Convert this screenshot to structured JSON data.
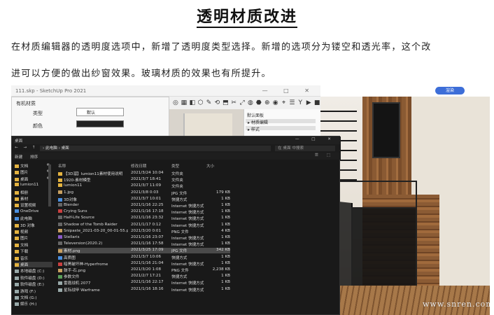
{
  "article": {
    "title": "透明材质改进",
    "paragraph_line1": "在材质编辑器的透明度选项中，新增了透明度类型选择。新增的选项分为镂空和透光率，这个改",
    "paragraph_line2": "进可以方便的做出纱窗效果。玻璃材质的效果也有所提升。"
  },
  "sketchup": {
    "window_title": "111.skp - SketchUp Pro 2021",
    "window_controls": "—  □  ✕",
    "dialog": {
      "section": "有机材质",
      "type_label": "类型",
      "type_value": "默认",
      "color_label": "颜色"
    },
    "tray": {
      "label": "默认面板",
      "items": [
        "▸ 材质编辑",
        "▸ 样式"
      ]
    },
    "render_button": "渲染",
    "toolbar_icons": [
      "◎",
      "▦",
      "◧",
      "⬡",
      "✎",
      "⟲",
      "⬒",
      "✂",
      "⤢",
      "◍",
      "⬣",
      "⊕",
      "◉",
      "⌖",
      "☰",
      "Y",
      "▶",
      "■"
    ]
  },
  "explorer": {
    "window_title": "桌面",
    "window_controls": "—  □  ✕",
    "nav_buttons": "← → ↑",
    "path": "› 此电脑 › 桌面",
    "search_placeholder": "在 桌面 中搜索",
    "command_bar": {
      "new": "新建",
      "tools": "☰ ⬚",
      "view": "排序"
    },
    "sidebar": [
      {
        "label": "文档",
        "icon": "folder",
        "pin": true
      },
      {
        "label": "图片",
        "icon": "folder",
        "pin": true
      },
      {
        "label": "桌面",
        "icon": "folder",
        "pin": true
      },
      {
        "label": "lumion11",
        "icon": "folder",
        "pin": false
      },
      {
        "label": "相册",
        "icon": "folder",
        "pin": false
      },
      {
        "label": "素材",
        "icon": "folder",
        "pin": false
      },
      {
        "label": "设置视频",
        "icon": "folder",
        "pin": false
      },
      {
        "label": "OneDrive",
        "icon": "cloud",
        "pin": false
      },
      {
        "label": "此电脑",
        "icon": "pc",
        "pin": false
      },
      {
        "label": "3D 对象",
        "icon": "folder",
        "pin": false
      },
      {
        "label": "视频",
        "icon": "folder",
        "pin": false
      },
      {
        "label": "图片",
        "icon": "folder",
        "pin": false
      },
      {
        "label": "文档",
        "icon": "folder",
        "pin": false
      },
      {
        "label": "下载",
        "icon": "folder",
        "pin": false
      },
      {
        "label": "音乐",
        "icon": "folder",
        "pin": false
      },
      {
        "label": "桌面",
        "icon": "folder",
        "pin": false,
        "active": true
      },
      {
        "label": "本地磁盘 (C:)",
        "icon": "drive",
        "pin": false
      },
      {
        "label": "软件磁盘 (D:)",
        "icon": "drive",
        "pin": false
      },
      {
        "label": "软件磁盘 (E:)",
        "icon": "drive",
        "pin": false
      },
      {
        "label": "游戏 (F:)",
        "icon": "drive",
        "pin": false
      },
      {
        "label": "文档 (G:)",
        "icon": "drive",
        "pin": false
      },
      {
        "label": "娱乐 (H:)",
        "icon": "drive",
        "pin": false
      }
    ],
    "columns": {
      "name": "名称",
      "date": "修改日期",
      "type": "类型",
      "size": "大小"
    },
    "files": [
      {
        "name": "【3D溜】lumion11素材使用说明",
        "date": "2021/3/24 10:04",
        "type": "文件夹",
        "size": "",
        "color": "folder"
      },
      {
        "name": "1920-素材模型",
        "date": "2021/3/7 18:41",
        "type": "文件夹",
        "size": "",
        "color": "folder"
      },
      {
        "name": "lumion11",
        "date": "2021/3/7 11:09",
        "type": "文件夹",
        "size": "",
        "color": "folder"
      },
      {
        "name": "1.jpg",
        "date": "2021/3/8 0:03",
        "type": "JPG 文件",
        "size": "179 KB",
        "color": "img"
      },
      {
        "name": "3D对象",
        "date": "2021/3/7 10:01",
        "type": "快捷方式",
        "size": "1 KB",
        "color": "blue"
      },
      {
        "name": "Blender",
        "date": "2021/1/16 22:25",
        "type": "Internet 快捷方式",
        "size": "1 KB",
        "color": "dark"
      },
      {
        "name": "Crying Suns",
        "date": "2021/1/16 17:18",
        "type": "Internet 快捷方式",
        "size": "1 KB",
        "color": "red"
      },
      {
        "name": "Half-Life Source",
        "date": "2021/1/16 23:32",
        "type": "Internet 快捷方式",
        "size": "1 KB",
        "color": "dark"
      },
      {
        "name": "Shadow of the Tomb Raider",
        "date": "2021/1/17 0:12",
        "type": "Internet 快捷方式",
        "size": "1 KB",
        "color": "dark"
      },
      {
        "name": "Snipaste_2021-03-20_00-01-55.png",
        "date": "2021/3/20 0:01",
        "type": "PNG 文件",
        "size": "4 KB",
        "color": "img"
      },
      {
        "name": "Stellaris",
        "date": "2021/1/16 23:07",
        "type": "Internet 快捷方式",
        "size": "1 KB",
        "color": "purple"
      },
      {
        "name": "Televersion(2020.2)",
        "date": "2021/1/16 17:58",
        "type": "Internet 快捷方式",
        "size": "1 KB",
        "color": "dark"
      },
      {
        "name": "素材.png",
        "date": "2021/3/25 17:09",
        "type": "JPG 文件",
        "size": "342 KB",
        "color": "img",
        "selected": true
      },
      {
        "name": "高质图",
        "date": "2021/3/7 10:06",
        "type": "快捷方式",
        "size": "1 KB",
        "color": "blue"
      },
      {
        "name": "暗黑破坏神-Hyperfrome",
        "date": "2021/1/16 21:04",
        "type": "Internet 快捷方式",
        "size": "1 KB",
        "color": "red"
      },
      {
        "name": "鼓手-石.png",
        "date": "2021/3/20 1:08",
        "type": "PNG 文件",
        "size": "2,238 KB",
        "color": "img"
      },
      {
        "name": "参数文件",
        "date": "2021/2/7 17:21",
        "type": "快捷方式",
        "size": "1 KB",
        "color": "green"
      },
      {
        "name": "雷霆战机 2077",
        "date": "2021/1/16 22:17",
        "type": "Internet 快捷方式",
        "size": "1 KB",
        "color": "gray"
      },
      {
        "name": "星际战甲 Warframe",
        "date": "2021/1/16 18:16",
        "type": "Internet 快捷方式",
        "size": "1 KB",
        "color": "gray"
      }
    ]
  },
  "watermark": "www.snren.com"
}
